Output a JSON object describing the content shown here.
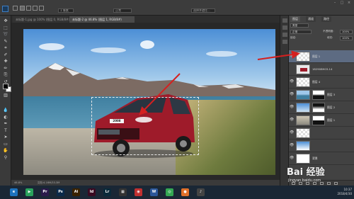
{
  "app": {
    "menu_icon": "photoshop-logo",
    "options": {
      "field_1": "1 像素",
      "field_2": "正常",
      "field_3": "选择并遮住...",
      "window_min": "–",
      "window_max": "□",
      "window_close": "×"
    }
  },
  "document_tabs": [
    {
      "label": "未标题-1.jpg @ 100% (图层 0, RGB/8#)"
    },
    {
      "label": "未标题-2 @ 46.8% (图层 1, RGB/8#)"
    }
  ],
  "status": {
    "zoom": "46.8%",
    "doc_info": "文档:4.16M/33.3M"
  },
  "toolbar": {
    "tools": [
      "move",
      "marquee",
      "lasso",
      "quick-select",
      "crop",
      "eyedropper",
      "healing",
      "brush",
      "clone",
      "history",
      "eraser",
      "gradient",
      "blur",
      "dodge",
      "pen",
      "type",
      "path-select",
      "shape",
      "hand",
      "zoom"
    ],
    "glyphs": [
      "✥",
      "⬚",
      "➰",
      "✎",
      "⌗",
      "✐",
      "✚",
      "✏",
      "⎘",
      "↺",
      "⌫",
      "▥",
      "💧",
      "◐",
      "✒",
      "T",
      "➤",
      "▭",
      "✋",
      "⚲"
    ]
  },
  "layers_panel": {
    "tabs": [
      "图层",
      "通道",
      "路径"
    ],
    "filter_label": "类型",
    "blend_mode": "正常",
    "opacity_label": "不透明度:",
    "opacity_value": "100%",
    "lock_label": "锁定:",
    "fill_label": "填充:",
    "fill_value": "100%",
    "layers": [
      {
        "name": "图层 1",
        "visible": true,
        "selected": true,
        "thumb": "checker"
      },
      {
        "name": "182908H03-14",
        "visible": false,
        "selected": false,
        "thumb": "car"
      },
      {
        "name": "图层 4",
        "visible": true,
        "selected": false,
        "thumb": "checker"
      },
      {
        "name": "图层 3",
        "visible": true,
        "selected": false,
        "thumb": "sea",
        "mask": true
      },
      {
        "name": "图层 2",
        "visible": true,
        "selected": false,
        "thumb": "sky",
        "mask": true
      },
      {
        "name": "图层 1",
        "visible": true,
        "selected": false,
        "thumb": "beach",
        "mask": true
      },
      {
        "name": "",
        "visible": true,
        "selected": false,
        "thumb": "checker"
      },
      {
        "name": "",
        "visible": true,
        "selected": false,
        "thumb": "sky"
      },
      {
        "name": "背景",
        "visible": true,
        "selected": false,
        "thumb": "white"
      }
    ]
  },
  "canvas": {
    "car_plate": "2008"
  },
  "taskbar": {
    "apps": [
      {
        "label": "e",
        "color": "#1e73be"
      },
      {
        "label": "▶",
        "color": "#2aa35c"
      },
      {
        "label": "Pr",
        "color": "#2a1a4a"
      },
      {
        "label": "Ps",
        "color": "#0b2a4a"
      },
      {
        "label": "Ai",
        "color": "#3a2200"
      },
      {
        "label": "Id",
        "color": "#3a0b22"
      },
      {
        "label": "Lr",
        "color": "#0b2a3a"
      },
      {
        "label": "▦",
        "color": "#333333"
      },
      {
        "label": "◉",
        "color": "#c03030"
      },
      {
        "label": "W",
        "color": "#2b579a"
      },
      {
        "label": "◎",
        "color": "#34a853"
      },
      {
        "label": "●",
        "color": "#e0702a"
      },
      {
        "label": "♪",
        "color": "#444444"
      }
    ],
    "clock_time": "10:37",
    "clock_date": "2018/4/30"
  },
  "watermark": {
    "logo": "Bai 经验",
    "url": "jingyan.baidu.com"
  },
  "colors": {
    "annotation_arrow": "#d42020",
    "selected_layer": "#5d6b82"
  }
}
